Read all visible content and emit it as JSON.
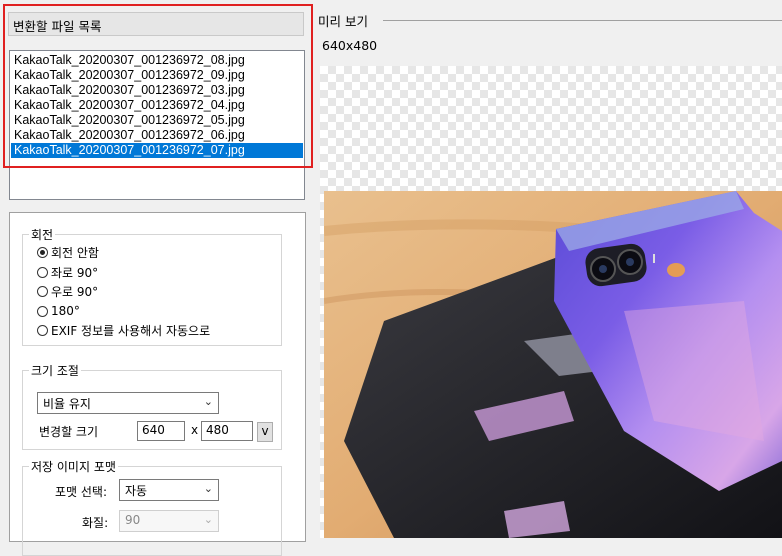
{
  "file_list": {
    "title": "변환할 파일 목록",
    "files": [
      "KakaoTalk_20200307_001236972_08.jpg",
      "KakaoTalk_20200307_001236972_09.jpg",
      "KakaoTalk_20200307_001236972_03.jpg",
      "KakaoTalk_20200307_001236972_04.jpg",
      "KakaoTalk_20200307_001236972_05.jpg",
      "KakaoTalk_20200307_001236972_06.jpg",
      "KakaoTalk_20200307_001236972_07.jpg"
    ],
    "selected_index": 6
  },
  "rotation": {
    "title": "회전",
    "options": [
      "회전 안함",
      "좌로 90°",
      "우로 90°",
      "180°",
      "EXIF 정보를 사용해서 자동으로"
    ],
    "selected_index": 0
  },
  "resize": {
    "title": "크기 조절",
    "mode_value": "비율 유지",
    "size_label": "변경할 크기",
    "width": "640",
    "separator": "x",
    "height": "480",
    "dropdown_button": "v"
  },
  "save_format": {
    "title": "저장 이미지 포맷",
    "format_label": "포맷 선택:",
    "format_value": "자동",
    "quality_label": "화질:",
    "quality_value": "90"
  },
  "preview": {
    "title": "미리 보기",
    "dimensions": "640x480"
  },
  "icons": {
    "dropdown": "chevron-down-icon",
    "radio": "radio-icon"
  },
  "colors": {
    "selection": "#0078d7",
    "highlight_border": "#e02020"
  }
}
